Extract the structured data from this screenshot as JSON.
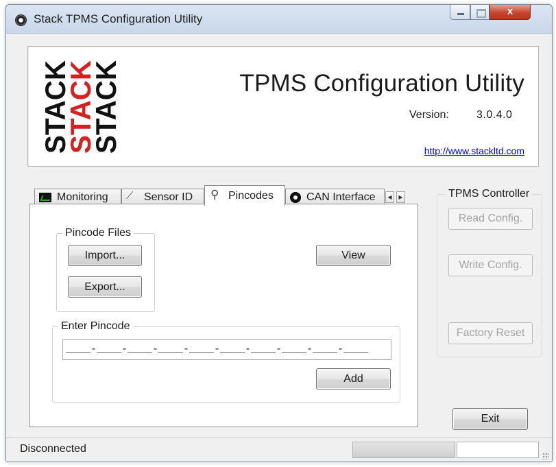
{
  "window": {
    "title": "Stack TPMS Configuration Utility",
    "close_glyph": "x"
  },
  "header": {
    "logo_text": "STACK",
    "title": "TPMS Configuration Utility",
    "version_label": "Version:",
    "version_value": "3.0.4.0",
    "website": "http://www.stackltd.com"
  },
  "tabs": [
    {
      "label": "Monitoring",
      "icon": "monitor-icon"
    },
    {
      "label": "Sensor ID",
      "icon": "sensor-icon"
    },
    {
      "label": "Pincodes",
      "icon": "key-icon",
      "active": true
    },
    {
      "label": "CAN Interface",
      "icon": "can-icon"
    }
  ],
  "pincodes": {
    "files_group_label": "Pincode Files",
    "import_label": "Import...",
    "export_label": "Export...",
    "view_label": "View",
    "enter_group_label": "Enter Pincode",
    "pincode_mask": "____-____-____-____-____-____-____-____-____-____",
    "add_label": "Add"
  },
  "controller": {
    "group_label": "TPMS Controller",
    "read_label": "Read Config.",
    "write_label": "Write Config.",
    "reset_label": "Factory Reset"
  },
  "exit_label": "Exit",
  "status": {
    "connection": "Disconnected"
  },
  "colors": {
    "logo_black": "#111111",
    "logo_red": "#d62020",
    "link": "#0000ee"
  }
}
